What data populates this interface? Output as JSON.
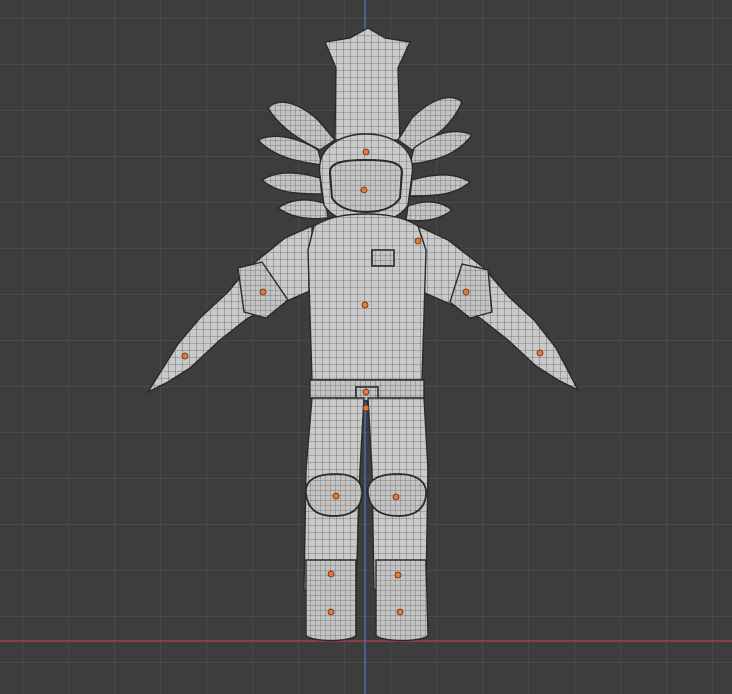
{
  "viewport": {
    "view": "front-orthographic",
    "shading": "solid",
    "overlay": "wireframe",
    "colors": {
      "background": "#3d3d3d",
      "grid_line": "#4a4a4a",
      "axis_x": "#b9414e",
      "axis_z": "#3f80c8",
      "mesh_fill": "#c8c8c8",
      "mesh_wire": "#2a2a2a",
      "origin_dot": "#e07a3a"
    }
  },
  "model": {
    "type": "character-mesh",
    "parts": [
      "crest",
      "side-gills",
      "helmet",
      "visor",
      "torso",
      "chest-badge",
      "left-arm",
      "right-arm",
      "belt",
      "belt-buckle",
      "legs",
      "left-knee-pad",
      "right-knee-pad",
      "left-boot",
      "right-boot"
    ],
    "object_origin_count": 16
  }
}
